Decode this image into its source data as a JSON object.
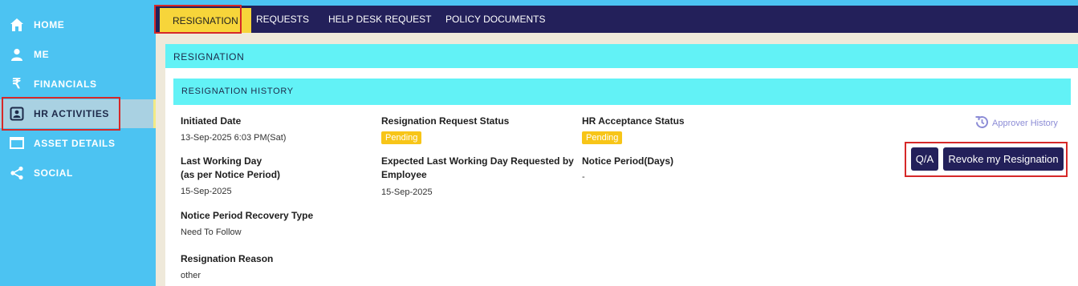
{
  "sidebar": {
    "items": [
      {
        "label": "HOME",
        "icon": "home-icon"
      },
      {
        "label": "ME",
        "icon": "user-icon"
      },
      {
        "label": "FINANCIALS",
        "icon": "rupee-icon"
      },
      {
        "label": "HR ACTIVITIES",
        "icon": "id-badge-icon"
      },
      {
        "label": "ASSET DETAILS",
        "icon": "monitor-icon"
      },
      {
        "label": "SOCIAL",
        "icon": "share-icon"
      }
    ]
  },
  "tabs": [
    "RESIGNATION",
    "REQUESTS",
    "HELP DESK REQUEST",
    "POLICY DOCUMENTS"
  ],
  "panel_title": "RESIGNATION",
  "section_title": "RESIGNATION HISTORY",
  "fields": {
    "initiated_date": {
      "label": "Initiated Date",
      "value": "13-Sep-2025 6:03 PM(Sat)"
    },
    "request_status": {
      "label": "Resignation Request Status",
      "value": "Pending"
    },
    "hr_status": {
      "label": "HR Acceptance Status",
      "value": "Pending"
    },
    "last_working_day": {
      "label1": "Last Working Day",
      "label2": "(as per Notice Period)",
      "value": "15-Sep-2025"
    },
    "expected_lwd": {
      "label1": "Expected Last Working Day Requested by",
      "label2": "Employee",
      "value": "15-Sep-2025"
    },
    "notice_period": {
      "label": "Notice Period(Days)",
      "value": "-"
    },
    "recovery_type": {
      "label": "Notice Period Recovery Type",
      "value": "Need To Follow"
    },
    "reason": {
      "label": "Resignation Reason",
      "value": "other"
    }
  },
  "approver_history": "Approver History",
  "buttons": {
    "qa": "Q/A",
    "revoke": "Revoke my Resignation"
  },
  "colors": {
    "sidebar": "#4cc3f2",
    "topbar": "#23205a",
    "active_tab": "#f7d53a",
    "header": "#62f2f6",
    "badge": "#f7c518",
    "highlight": "#d62828"
  }
}
